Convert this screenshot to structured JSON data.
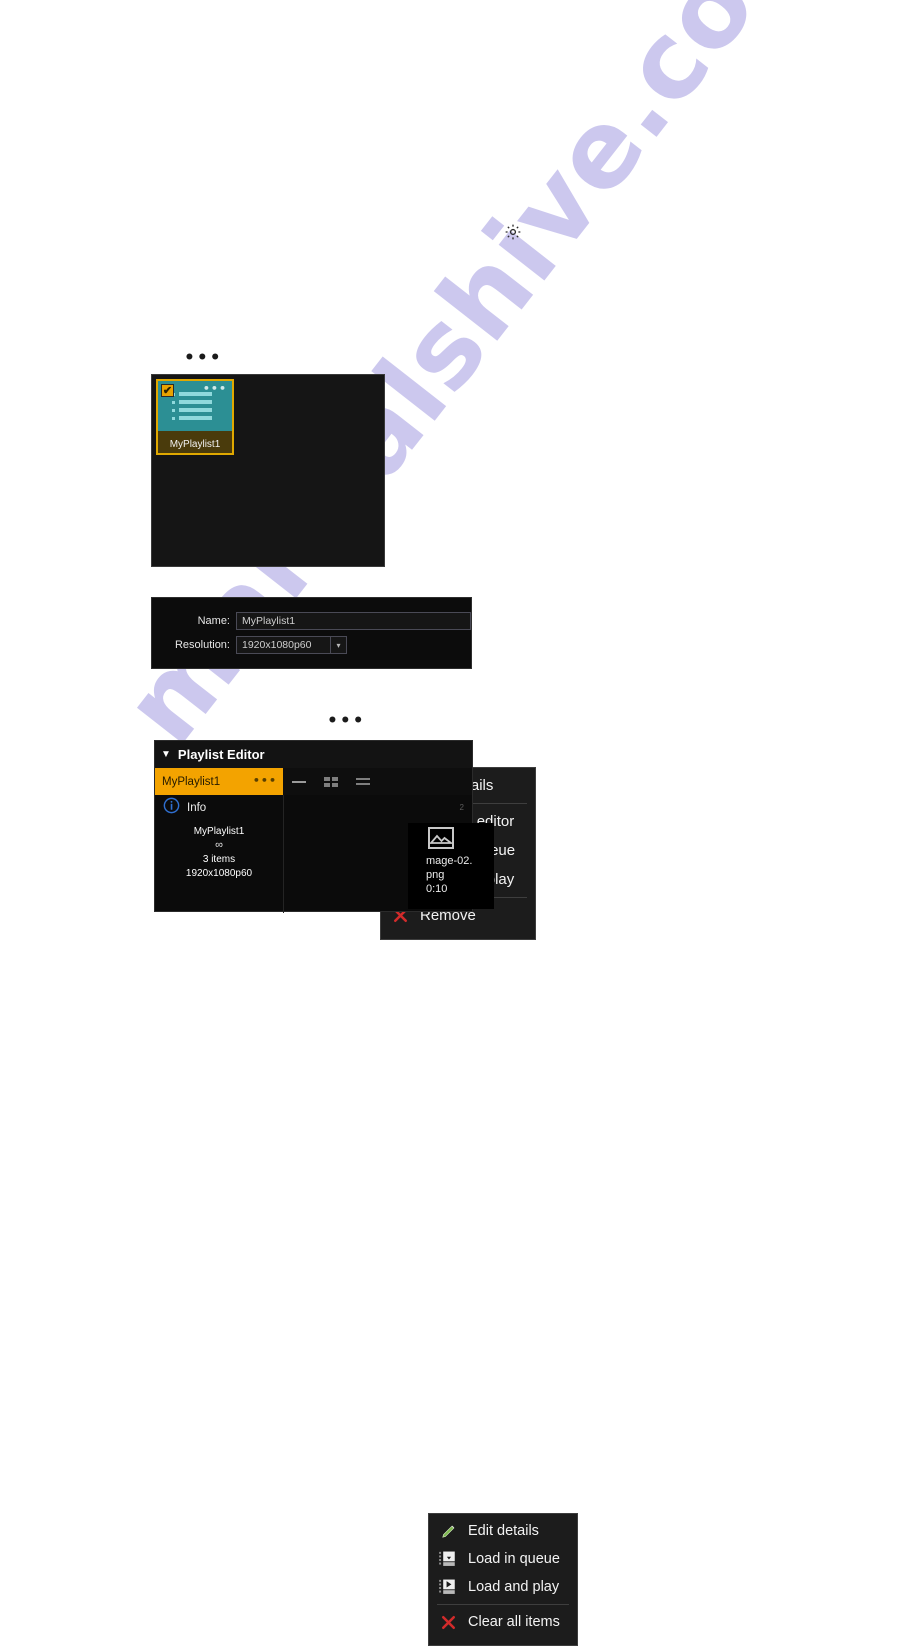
{
  "watermark": {
    "text": "manualshive.com"
  },
  "ellipsis": {
    "mark": "•••"
  },
  "gear": {
    "icon": "gear-icon"
  },
  "playlist_browser": {
    "tile": {
      "label": "MyPlaylist1",
      "checkbox_checked": "✔",
      "menu_dots": "•••",
      "thumb_icon": "playlist-list-icon",
      "border_color": "#e0a800",
      "thumb_color": "#2c8f94"
    },
    "context_menu": {
      "groups": [
        {
          "items": [
            {
              "label": "Edit details",
              "icon": "pencil-icon"
            }
          ]
        },
        {
          "items": [
            {
              "label": "Open in editor",
              "icon": "list-icon"
            },
            {
              "label": "Load in queue",
              "icon": "download-arrow-icon"
            },
            {
              "label": "Load and play",
              "icon": "play-icon"
            }
          ]
        },
        {
          "items": [
            {
              "label": "Remove",
              "icon": "red-x-icon"
            }
          ]
        }
      ]
    }
  },
  "details_form": {
    "name": {
      "label": "Name:",
      "value": "MyPlaylist1"
    },
    "resolution": {
      "label": "Resolution:",
      "value": "1920x1080p60",
      "dropdown_icon": "chevron-down-icon"
    }
  },
  "playlist_editor": {
    "title": "Playlist Editor",
    "collapse_icon": "▼",
    "tab": {
      "label": "MyPlaylist1",
      "menu_dots": "•••",
      "accent": "#f3a300"
    },
    "info": {
      "label": "Info",
      "icon": "info-circle-icon",
      "name": "MyPlaylist1",
      "loop": "∞",
      "items": "3 items",
      "resolution": "1920x1080p60"
    },
    "media": {
      "ruler_mark": "2",
      "thumb_icon": "image-icon",
      "name": "mage-02.\npng",
      "name_line1": "mage-02.",
      "name_line2": "png",
      "duration": "0:10"
    },
    "context_menu": {
      "groups": [
        {
          "items": [
            {
              "label": "Edit details",
              "icon": "pencil-icon"
            },
            {
              "label": "Load in queue",
              "icon": "download-arrow-icon"
            },
            {
              "label": "Load and play",
              "icon": "play-icon"
            }
          ]
        },
        {
          "items": [
            {
              "label": "Clear all items",
              "icon": "red-x-icon"
            }
          ]
        }
      ]
    }
  }
}
